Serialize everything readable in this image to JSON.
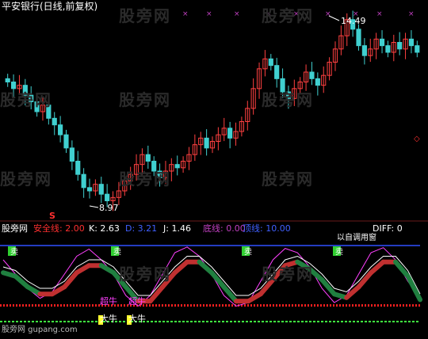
{
  "header": {
    "title": "平安银行(日线,前复权)",
    "title_color": "#ffffff"
  },
  "price_panel": {
    "high_label": "14.49",
    "low_label": "8.97",
    "s_marker": "S",
    "s_marker_color": "#ff3030",
    "up_color": "#ff4040",
    "down_color": "#40d0d0",
    "x_marker_color": "#c040c0"
  },
  "indicator_bar": {
    "site": "股旁网",
    "items": [
      {
        "label": "安全线: 2.00",
        "color": "#ff3030"
      },
      {
        "label": "K: 2.63",
        "color": "#ffffff"
      },
      {
        "label": "D: 3.21",
        "color": "#4060ff"
      },
      {
        "label": "J: 1.46",
        "color": "#ffffff"
      },
      {
        "label": "底线: 0.00",
        "color": "#c040c0"
      },
      {
        "label": "顶线: 10.00",
        "color": "#4060ff"
      }
    ],
    "diff_label": "DIFF: 0",
    "extra_label": "以自调用窗"
  },
  "signals": {
    "sell": "卖",
    "buy_big": "大牛",
    "buy_small": "超牛"
  },
  "footer": {
    "source": "股旁网 gupang.com"
  },
  "watermark": "股旁网",
  "chart_data": [
    {
      "type": "candlestick",
      "title": "平安银行(日线,前复权)",
      "annotations": {
        "max": 14.49,
        "min": 8.97
      },
      "close_series": [
        12.6,
        12.4,
        12.5,
        12.2,
        12.0,
        11.7,
        11.9,
        11.5,
        11.3,
        11.0,
        10.6,
        10.2,
        9.8,
        9.4,
        9.3,
        9.5,
        9.2,
        9.0,
        9.1,
        9.3,
        9.6,
        9.8,
        10.1,
        10.4,
        10.2,
        9.9,
        9.7,
        9.9,
        10.1,
        10.0,
        10.2,
        10.4,
        10.7,
        10.9,
        10.6,
        10.8,
        11.0,
        11.2,
        10.9,
        11.1,
        11.4,
        11.8,
        12.4,
        13.0,
        13.3,
        13.1,
        12.7,
        12.3,
        12.1,
        12.4,
        12.6,
        12.9,
        12.7,
        12.5,
        12.8,
        13.2,
        13.6,
        14.0,
        14.49,
        14.2,
        13.7,
        13.4,
        13.6,
        13.9,
        13.7,
        13.5,
        13.8,
        13.6,
        13.9,
        13.7,
        13.5
      ]
    },
    {
      "type": "line",
      "series": [
        {
          "name": "K",
          "values": [
            8,
            6,
            4,
            2.6,
            3.5,
            6,
            8.5,
            9.5,
            8,
            6,
            3,
            1.5,
            3,
            6,
            9,
            9.8,
            8.5,
            6,
            3,
            1.5,
            2,
            5,
            8,
            9.6,
            9,
            7,
            4,
            2,
            3,
            6,
            9,
            9.7,
            8,
            5,
            2.63
          ]
        },
        {
          "name": "D",
          "values": [
            7,
            6.5,
            5,
            4,
            4,
            5,
            7,
            8,
            8,
            7,
            5,
            3,
            3,
            5,
            7,
            8.5,
            8.5,
            7,
            5,
            3,
            3,
            4,
            6,
            8,
            8.5,
            7.5,
            6,
            4,
            3.5,
            5,
            7,
            8.5,
            8.5,
            6.5,
            3.21
          ]
        }
      ],
      "ylim": [
        0,
        10
      ]
    }
  ]
}
